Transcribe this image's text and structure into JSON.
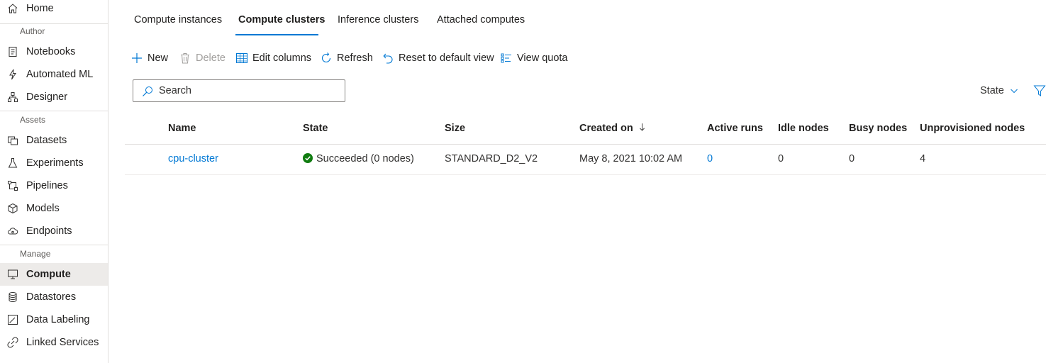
{
  "sidebar": {
    "home": "Home",
    "section_author": "Author",
    "notebooks": "Notebooks",
    "automated_ml": "Automated ML",
    "designer": "Designer",
    "section_assets": "Assets",
    "datasets": "Datasets",
    "experiments": "Experiments",
    "pipelines": "Pipelines",
    "models": "Models",
    "endpoints": "Endpoints",
    "section_manage": "Manage",
    "compute": "Compute",
    "datastores": "Datastores",
    "data_labeling": "Data Labeling",
    "linked_services": "Linked Services"
  },
  "tabs": {
    "compute_instances": "Compute instances",
    "compute_clusters": "Compute clusters",
    "inference_clusters": "Inference clusters",
    "attached_computes": "Attached computes"
  },
  "toolbar": {
    "new": "New",
    "delete": "Delete",
    "edit_columns": "Edit columns",
    "refresh": "Refresh",
    "reset_view": "Reset to default view",
    "view_quota": "View quota"
  },
  "search": {
    "placeholder": "Search"
  },
  "state_filter": "State",
  "table": {
    "columns": {
      "name": "Name",
      "state": "State",
      "size": "Size",
      "created_on": "Created on",
      "active_runs": "Active runs",
      "idle_nodes": "Idle nodes",
      "busy_nodes": "Busy nodes",
      "unprovisioned_nodes": "Unprovisioned nodes"
    },
    "rows": [
      {
        "name": "cpu-cluster",
        "state": "Succeeded (0 nodes)",
        "size": "STANDARD_D2_V2",
        "created_on": "May 8, 2021 10:02 AM",
        "active_runs": "0",
        "idle_nodes": "0",
        "busy_nodes": "0",
        "unprovisioned_nodes": "4"
      }
    ]
  },
  "colors": {
    "accent": "#0078d4",
    "success": "#107c10",
    "active_nav_bg": "#edebe9"
  }
}
